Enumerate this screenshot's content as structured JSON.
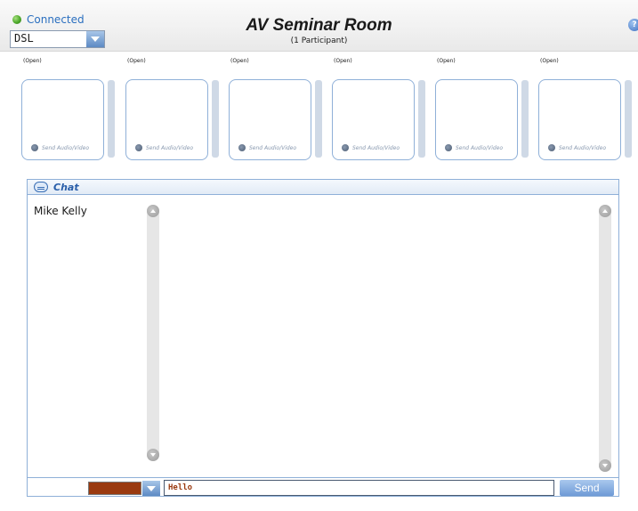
{
  "header": {
    "status_text": "Connected",
    "status_color": "#4ca82a",
    "connection_type": "DSL",
    "room_title": "AV Seminar Room",
    "participants_text": "(1 Participant)",
    "help_icon": "question-circle-icon"
  },
  "video_slots": [
    {
      "label": "(Open)",
      "send_label": "Send Audio/Video"
    },
    {
      "label": "(Open)",
      "send_label": "Send Audio/Video"
    },
    {
      "label": "(Open)",
      "send_label": "Send Audio/Video"
    },
    {
      "label": "(Open)",
      "send_label": "Send Audio/Video"
    },
    {
      "label": "(Open)",
      "send_label": "Send Audio/Video"
    },
    {
      "label": "(Open)",
      "send_label": "Send Audio/Video"
    }
  ],
  "chat": {
    "title": "Chat",
    "users": [
      "Mike Kelly"
    ],
    "message_input_value": "Hello",
    "text_color": "#9a3a10",
    "send_label": "Send"
  }
}
